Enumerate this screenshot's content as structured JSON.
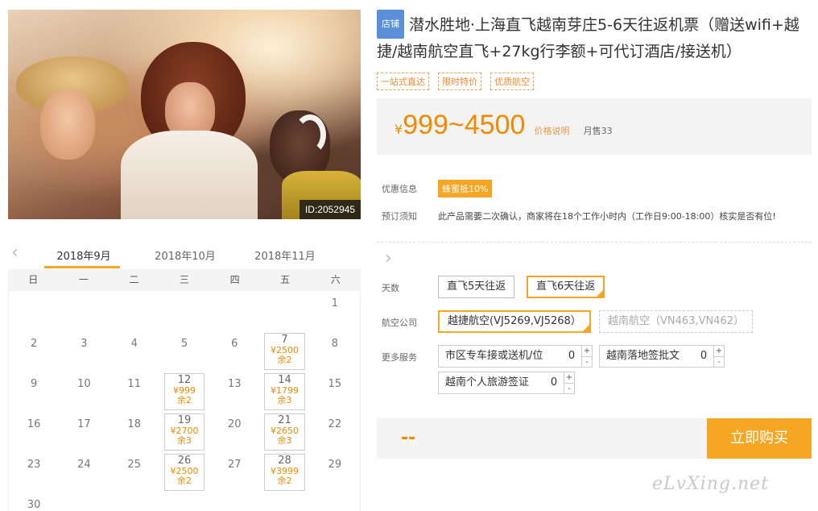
{
  "photo": {
    "id_label": "ID:2052945"
  },
  "calendar": {
    "months": [
      "2018年9月",
      "2018年10月",
      "2018年11月"
    ],
    "weekdays": [
      "日",
      "一",
      "二",
      "三",
      "四",
      "五",
      "六"
    ],
    "rows": [
      [
        {
          "d": ""
        },
        {
          "d": ""
        },
        {
          "d": ""
        },
        {
          "d": ""
        },
        {
          "d": ""
        },
        {
          "d": ""
        },
        {
          "d": "1"
        }
      ],
      [
        {
          "d": "2"
        },
        {
          "d": "3"
        },
        {
          "d": "4"
        },
        {
          "d": "5"
        },
        {
          "d": "6"
        },
        {
          "d": "7",
          "p": "¥2500",
          "l": "余2"
        },
        {
          "d": "8"
        }
      ],
      [
        {
          "d": "9"
        },
        {
          "d": "10"
        },
        {
          "d": "11"
        },
        {
          "d": "12",
          "p": "¥999",
          "l": "余2"
        },
        {
          "d": "13"
        },
        {
          "d": "14",
          "p": "¥1799",
          "l": "余3"
        },
        {
          "d": "15"
        }
      ],
      [
        {
          "d": "16"
        },
        {
          "d": "17"
        },
        {
          "d": "18"
        },
        {
          "d": "19",
          "p": "¥2700",
          "l": "余3"
        },
        {
          "d": "20"
        },
        {
          "d": "21",
          "p": "¥2650",
          "l": "余3"
        },
        {
          "d": "22"
        }
      ],
      [
        {
          "d": "23"
        },
        {
          "d": "24"
        },
        {
          "d": "25"
        },
        {
          "d": "26",
          "p": "¥2500",
          "l": "余2"
        },
        {
          "d": "27"
        },
        {
          "d": "28",
          "p": "¥3999",
          "l": "余2"
        },
        {
          "d": "29"
        }
      ],
      [
        {
          "d": "30"
        },
        {
          "d": ""
        },
        {
          "d": ""
        },
        {
          "d": ""
        },
        {
          "d": ""
        },
        {
          "d": ""
        },
        {
          "d": ""
        }
      ]
    ]
  },
  "product": {
    "shop_badge": "店铺",
    "title": "潜水胜地·上海直飞越南芽庄5-6天往返机票（赠送wifi+越捷/越南航空直飞+27kg行李额+可代订酒店/接送机）",
    "tags": [
      "一站式直达",
      "限时特价",
      "优质航空"
    ],
    "price_currency": "¥",
    "price_range": "999~4500",
    "price_explain": "价格说明",
    "monthly_sales": "月售33"
  },
  "info": {
    "discount_label": "优惠信息",
    "discount_badge": "蜂蜜抵10%",
    "notice_label": "预订须知",
    "notice_text": "此产品需要二次确认，商家将在18个工作小时内（工作日9:00-18:00）核实是否有位!"
  },
  "options": {
    "days_label": "天数",
    "days": [
      "直飞5天往返",
      "直飞6天往返"
    ],
    "airline_label": "航空公司",
    "airlines": [
      "越捷航空(VJ5269,VJ5268）",
      "越南航空（VN463,VN462）"
    ],
    "services_label": "更多服务",
    "services": [
      {
        "name": "市区专车接或送机/位",
        "qty": "0"
      },
      {
        "name": "越南落地签批文",
        "qty": "0"
      },
      {
        "name": "越南个人旅游签证",
        "qty": "0"
      }
    ],
    "plus": "+",
    "minus": "-"
  },
  "buy": {
    "total": "--",
    "button": "立即购买"
  },
  "watermark": "eLvXing.net",
  "colors": {
    "accent": "#f5a623",
    "price": "#f08a00",
    "badge": "#5b8fd8"
  }
}
